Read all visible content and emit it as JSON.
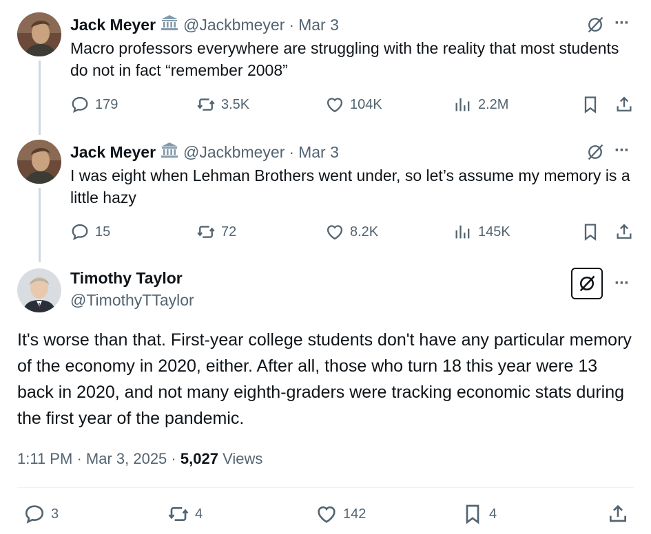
{
  "tweets": [
    {
      "author": "Jack Meyer",
      "handle": "@Jackbmeyer",
      "sep": "·",
      "date": "Mar 3",
      "text": "Macro professors everywhere are struggling with the reality that most students do not in fact “remember 2008”",
      "replies": "179",
      "reposts": "3.5K",
      "likes": "104K",
      "views": "2.2M"
    },
    {
      "author": "Jack Meyer",
      "handle": "@Jackbmeyer",
      "sep": "·",
      "date": "Mar 3",
      "text": "I was eight when Lehman Brothers went under, so let’s assume my memory is a little hazy",
      "replies": "15",
      "reposts": "72",
      "likes": "8.2K",
      "views": "145K"
    }
  ],
  "main": {
    "author": "Timothy Taylor",
    "handle": "@TimothyTTaylor",
    "text": "It's worse than that. First-year college students don't have any particular memory of the economy in 2020, either. After all, those who turn 18 this year were 13 back in 2020, and not many eighth-graders were tracking economic stats during the first year of the pandemic.",
    "time": "1:11 PM",
    "sep1": "·",
    "date": "Mar 3, 2025",
    "sep2": "·",
    "views_count": "5,027",
    "views_label": "Views",
    "replies": "3",
    "reposts": "4",
    "likes": "142",
    "bookmarks": "4"
  },
  "icons": {
    "reply": "speech-bubble-icon",
    "repost": "repost-arrows-icon",
    "like": "heart-icon",
    "views": "bar-chart-icon",
    "bookmark": "bookmark-icon",
    "share": "share-upload-icon",
    "grok": "grok-slash-icon",
    "more": "more-dots-icon",
    "verified_org": "government-building-icon"
  },
  "colors": {
    "text": "#0f1419",
    "muted": "#536471",
    "divider": "#eff3f4",
    "thread": "#cfd9de"
  }
}
